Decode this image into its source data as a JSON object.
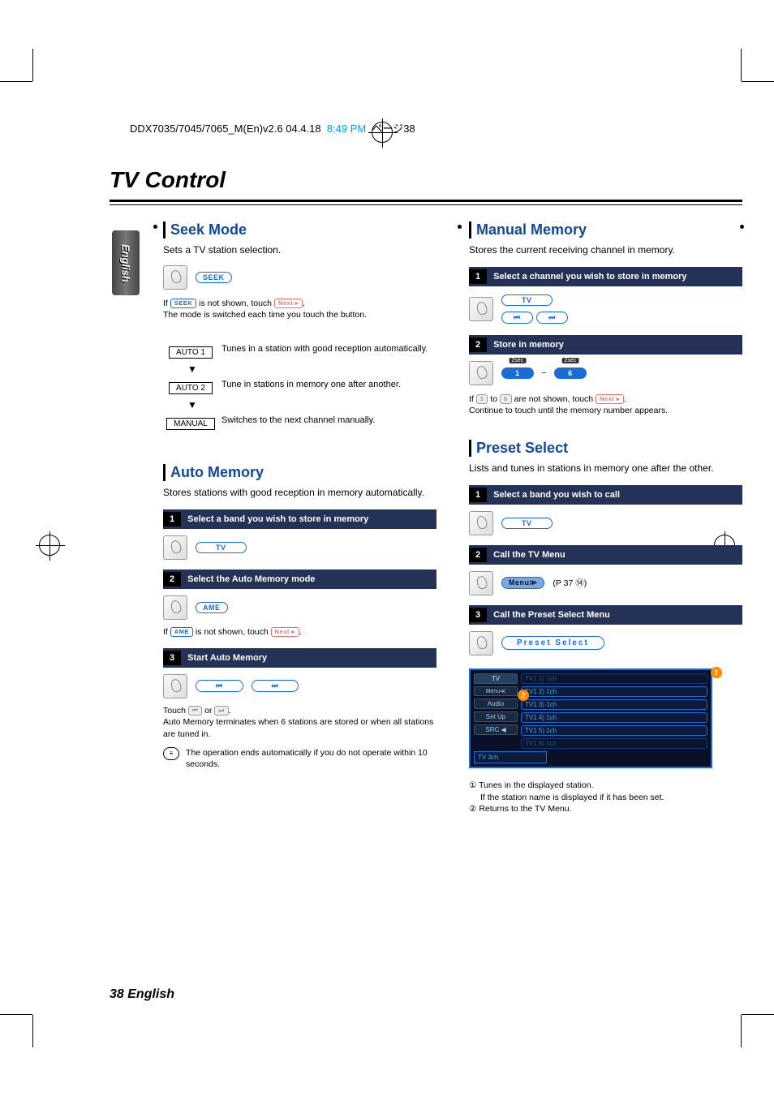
{
  "header": {
    "doc_id": "DDX7035/7045/7065_M(En)v2.6  04.4.18",
    "time": "8:49 PM",
    "page_marker": "ページ38"
  },
  "sidebar": {
    "lang": "English"
  },
  "page_title": "TV Control",
  "left": {
    "seek": {
      "title": "Seek Mode",
      "desc": "Sets a TV station selection.",
      "chip": "SEEK",
      "note1_pre": "If ",
      "note1_mid": " is not shown, touch ",
      "next_chip": "Next ▸",
      "note2": "The mode is switched each time you touch the button.",
      "auto1": "AUTO 1",
      "auto1_desc": "Tunes in a station with good reception automatically.",
      "auto2": "AUTO 2",
      "auto2_desc": "Tune in stations in memory one after another.",
      "manual": "MANUAL",
      "manual_desc": "Switches to the next channel manually."
    },
    "auto_mem": {
      "title": "Auto Memory",
      "desc": "Stores stations with good reception in memory automatically.",
      "step1": "Select a band you wish to store in memory",
      "band_chip": "TV",
      "step2": "Select the Auto Memory mode",
      "ame_chip": "AME",
      "note1_pre": "If ",
      "note1_mid": " is not shown, touch ",
      "next_chip": "Next ▸",
      "step3": "Start Auto Memory",
      "touch_pre": "Touch ",
      "or": " or ",
      "touch_post": ".",
      "note3": "Auto Memory terminates when 6 stations are stored or when all stations are tuned in.",
      "note4": "The operation ends automatically if you do not operate within 10 seconds."
    }
  },
  "right": {
    "manual_mem": {
      "title": "Manual Memory",
      "desc": "Stores the current receiving channel in memory.",
      "step1": "Select a channel you wish to store in memory",
      "band_chip": "TV",
      "step2": "Store in memory",
      "preset1": "1",
      "preset6": "6",
      "sec": "2sec",
      "note1_pre": "If ",
      "to": " to ",
      "note1_mid": " are not shown, touch ",
      "next_chip": "Next ▸",
      "note2": "Continue to touch until the memory number appears."
    },
    "preset": {
      "title": "Preset Select",
      "desc": "Lists and tunes in stations in memory one after the other.",
      "step1": "Select a band you wish to call",
      "band_chip": "TV",
      "step2": "Call the TV Menu",
      "menu_chip": "Menu≫",
      "menu_ref": "(P 37 ⑭)",
      "step3": "Call the Preset Select Menu",
      "preset_chip": "Preset Select",
      "screen": {
        "side_tv": "TV",
        "side_menu": "Menu≪",
        "side_audio": "Audio",
        "side_setup": "Set Up",
        "side_src": "SRC ◀",
        "items": [
          "TV1  1) 1ch",
          "TV1  2) 1ch",
          "TV1  3) 1ch",
          "TV1  4) 1ch",
          "TV1  5) 1ch",
          "TV1  6) 1ch"
        ],
        "status": "TV          3ch"
      },
      "foot1": "① Tunes in the displayed station.",
      "foot1b": "If the station name is displayed if it has been set.",
      "foot2": "② Returns to the TV Menu."
    }
  },
  "steps": {
    "s1": "1",
    "s2": "2",
    "s3": "3"
  },
  "icons": {
    "prev": "⏮",
    "next": "⏭"
  },
  "footer": "38 English"
}
